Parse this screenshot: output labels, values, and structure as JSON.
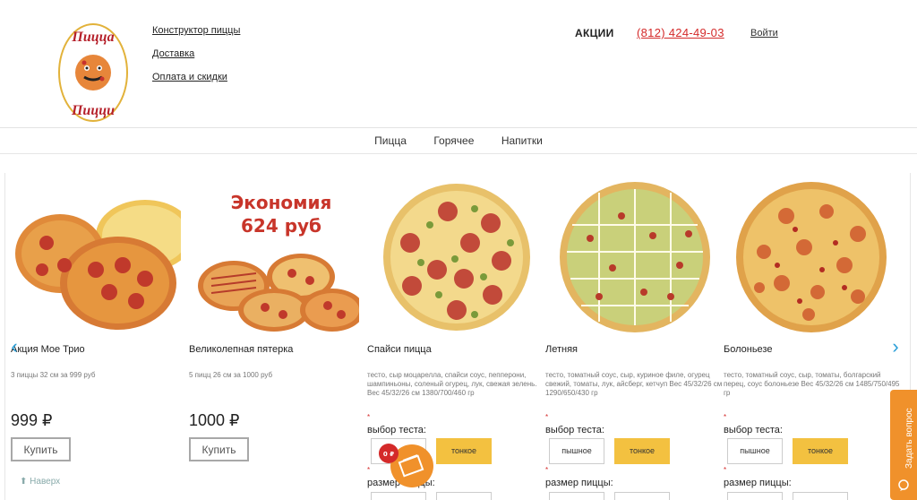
{
  "header": {
    "logo": {
      "line1": "Пицца",
      "line2": "Пицци"
    },
    "links": [
      "Конструктор пиццы",
      "Доставка",
      "Оплата и скидки"
    ],
    "promo": "АКЦИИ",
    "phone": "(812) 424-49-03",
    "login": "Войти"
  },
  "nav": {
    "items": [
      "Пицца",
      "Горячее",
      "Напитки"
    ]
  },
  "products": [
    {
      "name": "Акция Мое Трио",
      "desc": "3 пиццы 32 см за 999 руб",
      "price": "999 ₽",
      "buy": "Купить"
    },
    {
      "name": "Великолепная пятерка",
      "desc": "5 пицц 26 см за 1000 руб",
      "price": "1000 ₽",
      "buy": "Купить",
      "banner_line1": "Экономия",
      "banner_line2": "624 руб"
    },
    {
      "name": "Спайси пицца",
      "desc": "тесто, сыр моцарелла, спайси соус, пепперони, шампиньоны, соленый огурец, лук, свежая зелень. Вес 45/32/26 см 1380/700/460 гр",
      "dough_label": "выбор теста:",
      "dough_options": [
        "пышное",
        "тонкое"
      ],
      "size_label": "размер пиццы:"
    },
    {
      "name": "Летняя",
      "desc": "тесто, томатный соус, сыр, куриное филе, огурец свежий, томаты, лук, айсберг, кетчуп Вес 45/32/26 см 1290/650/430 гр",
      "dough_label": "выбор теста:",
      "dough_options": [
        "пышное",
        "тонкое"
      ],
      "size_label": "размер пиццы:"
    },
    {
      "name": "Болоньезе",
      "desc": "тесто, томатный соус, сыр, томаты, болгарский перец, соус болоньезе Вес 45/32/26 см 1485/750/495 гр",
      "dough_label": "выбор теста:",
      "dough_options": [
        "пышное",
        "тонкое"
      ],
      "size_label": "размер пиццы:"
    }
  ],
  "required_mark": "*",
  "back_to_top": "⬆ Наверх",
  "ask_question": "Задать вопрос",
  "cart": {
    "amount": "0 ₽"
  },
  "colors": {
    "accent": "#f3c140",
    "phone": "#d42a2a",
    "arrow": "#2a9fd8",
    "ask": "#f0912b"
  }
}
